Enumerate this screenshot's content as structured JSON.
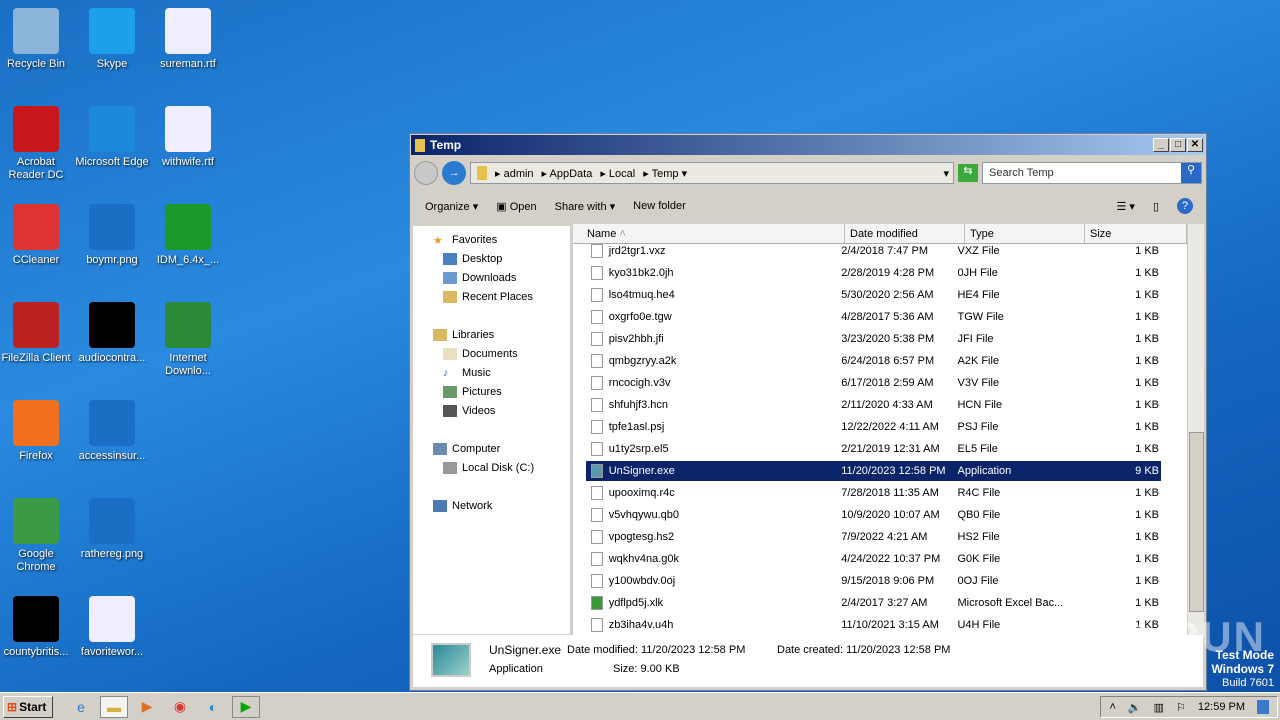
{
  "desktop": {
    "icons": [
      {
        "label": "Recycle Bin",
        "col": 0,
        "row": 0,
        "color": "#8ab4d8"
      },
      {
        "label": "Acrobat Reader DC",
        "col": 0,
        "row": 1,
        "color": "#c8161d"
      },
      {
        "label": "CCleaner",
        "col": 0,
        "row": 2,
        "color": "#d33"
      },
      {
        "label": "FileZilla Client",
        "col": 0,
        "row": 3,
        "color": "#b22"
      },
      {
        "label": "Firefox",
        "col": 0,
        "row": 4,
        "color": "#f07020"
      },
      {
        "label": "Google Chrome",
        "col": 0,
        "row": 5,
        "color": "#3a9a45"
      },
      {
        "label": "countybritis...",
        "col": 0,
        "row": 6,
        "color": "#000"
      },
      {
        "label": "Skype",
        "col": 1,
        "row": 0,
        "color": "#1da0e8"
      },
      {
        "label": "Microsoft Edge",
        "col": 1,
        "row": 1,
        "color": "#1c8ad8"
      },
      {
        "label": "boymr.png",
        "col": 1,
        "row": 2,
        "color": "#1a6fc4"
      },
      {
        "label": "audiocontra...",
        "col": 1,
        "row": 3,
        "color": "#000"
      },
      {
        "label": "accessinsur...",
        "col": 1,
        "row": 4,
        "color": "#1a6fc4"
      },
      {
        "label": "rathereg.png",
        "col": 1,
        "row": 5,
        "color": "#1a6fc4"
      },
      {
        "label": "favoritewor...",
        "col": 1,
        "row": 6,
        "color": "#eef"
      },
      {
        "label": "sureman.rtf",
        "col": 2,
        "row": 0,
        "color": "#eef"
      },
      {
        "label": "withwife.rtf",
        "col": 2,
        "row": 1,
        "color": "#eef"
      },
      {
        "label": "IDM_6.4x_...",
        "col": 2,
        "row": 2,
        "color": "#1a9a2a"
      },
      {
        "label": "Internet Downlo...",
        "col": 2,
        "row": 3,
        "color": "#2a8a3a"
      }
    ]
  },
  "window": {
    "title": "Temp",
    "breadcrumb": [
      "admin",
      "AppData",
      "Local",
      "Temp"
    ],
    "search_placeholder": "Search Temp",
    "toolbar": {
      "organize": "Organize",
      "open": "Open",
      "share": "Share with",
      "new_folder": "New folder"
    },
    "nav": {
      "favorites": "Favorites",
      "desktop": "Desktop",
      "downloads": "Downloads",
      "recent": "Recent Places",
      "libraries": "Libraries",
      "documents": "Documents",
      "music": "Music",
      "pictures": "Pictures",
      "videos": "Videos",
      "computer": "Computer",
      "local_disk": "Local Disk (C:)",
      "network": "Network"
    },
    "columns": {
      "name": "Name",
      "date": "Date modified",
      "type": "Type",
      "size": "Size"
    },
    "files": [
      [
        "jrd2tgr1.vxz",
        "2/4/2018 7:47 PM",
        "VXZ File",
        "1 KB"
      ],
      [
        "kyo31bk2.0jh",
        "2/28/2019 4:28 PM",
        "0JH File",
        "1 KB"
      ],
      [
        "lso4tmuq.he4",
        "5/30/2020 2:56 AM",
        "HE4 File",
        "1 KB"
      ],
      [
        "oxgrfo0e.tgw",
        "4/28/2017 5:36 AM",
        "TGW File",
        "1 KB"
      ],
      [
        "pisv2hbh.jfi",
        "3/23/2020 5:38 PM",
        "JFI File",
        "1 KB"
      ],
      [
        "qmbgzryy.a2k",
        "6/24/2018 6:57 PM",
        "A2K File",
        "1 KB"
      ],
      [
        "rncocigh.v3v",
        "6/17/2018 2:59 AM",
        "V3V File",
        "1 KB"
      ],
      [
        "shfuhjf3.hcn",
        "2/11/2020 4:33 AM",
        "HCN File",
        "1 KB"
      ],
      [
        "tpfe1asl.psj",
        "12/22/2022 4:11 AM",
        "PSJ File",
        "1 KB"
      ],
      [
        "u1ty2srp.el5",
        "2/21/2019 12:31 AM",
        "EL5 File",
        "1 KB"
      ],
      [
        "UnSigner.exe",
        "11/20/2023 12:58 PM",
        "Application",
        "9 KB"
      ],
      [
        "upooximq.r4c",
        "7/28/2018 11:35 AM",
        "R4C File",
        "1 KB"
      ],
      [
        "v5vhqywu.qb0",
        "10/9/2020 10:07 AM",
        "QB0 File",
        "1 KB"
      ],
      [
        "vpogtesg.hs2",
        "7/9/2022 4:21 AM",
        "HS2 File",
        "1 KB"
      ],
      [
        "wqkhv4na.g0k",
        "4/24/2022 10:37 PM",
        "G0K File",
        "1 KB"
      ],
      [
        "y100wbdv.0oj",
        "9/15/2018 9:06 PM",
        "0OJ File",
        "1 KB"
      ],
      [
        "ydflpd5j.xlk",
        "2/4/2017 3:27 AM",
        "Microsoft Excel Bac...",
        "1 KB"
      ],
      [
        "zb3iha4v.u4h",
        "11/10/2021 3:15 AM",
        "U4H File",
        "1 KB"
      ]
    ],
    "selected_index": 10,
    "details": {
      "name": "UnSigner.exe",
      "type": "Application",
      "modified": "Date modified: 11/20/2023 12:58 PM",
      "created": "Date created: 11/20/2023 12:58 PM",
      "size": "Size: 9.00 KB"
    }
  },
  "taskbar": {
    "start": "Start",
    "clock": "12:59 PM"
  },
  "watermark": {
    "line1": "Test Mode",
    "line2": "Windows 7",
    "line3": "Build 7601",
    "brand": "ANY RUN"
  }
}
